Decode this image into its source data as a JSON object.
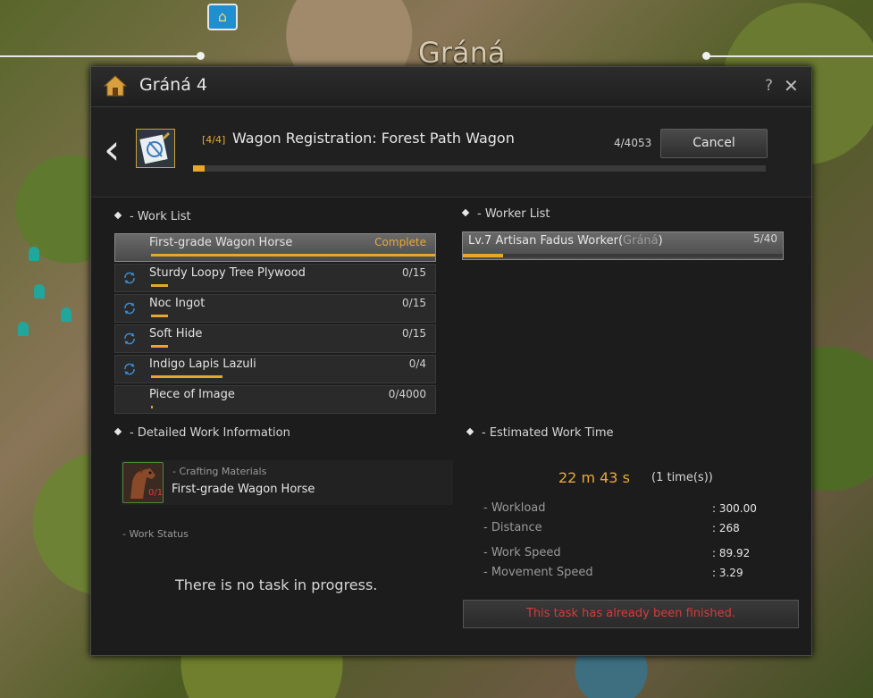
{
  "map": {
    "town_label": "Gráná"
  },
  "window": {
    "title": "Gráná 4",
    "help_label": "?",
    "close_label": "✕",
    "colors": {
      "accent": "#e8a72a",
      "alert": "#d93a3a"
    }
  },
  "task": {
    "step": "[4/4]",
    "title": "Wagon Registration: Forest Path Wagon",
    "count": "4/4053",
    "cancel_label": "Cancel",
    "progress_fraction": 0.001
  },
  "work_list": {
    "heading": "- Work List",
    "items": [
      {
        "name": "First-grade Wagon Horse",
        "count": "Complete",
        "progress": 1.0,
        "icon": "none",
        "selected": true
      },
      {
        "name": "Sturdy Loopy Tree Plywood",
        "count": "0/15",
        "progress": 0.06,
        "icon": "refresh-icon"
      },
      {
        "name": "Noc Ingot",
        "count": "0/15",
        "progress": 0.06,
        "icon": "refresh-icon"
      },
      {
        "name": "Soft Hide",
        "count": "0/15",
        "progress": 0.06,
        "icon": "refresh-icon"
      },
      {
        "name": "Indigo Lapis Lazuli",
        "count": "0/4",
        "progress": 0.25,
        "icon": "refresh-icon"
      },
      {
        "name": "Piece of Image",
        "count": "0/4000",
        "progress": 0.002,
        "icon": "none"
      }
    ]
  },
  "worker_list": {
    "heading": "- Worker List",
    "worker": {
      "name": "Lv.7 Artisan Fadus Worker(",
      "town": "Gráná",
      "close": ")",
      "count": "5/40",
      "progress": 0.125
    }
  },
  "detail": {
    "heading": "- Detailed Work Information",
    "material_label": "- Crafting Materials",
    "material_name": "First-grade Wagon Horse",
    "material_qty": "0/1",
    "status_label": "- Work Status",
    "no_task": "There is no task in progress."
  },
  "estimate": {
    "heading": "- Estimated Work Time",
    "time": "22 m 43 s",
    "times": "(1 time(s))",
    "stats": [
      {
        "label": "- Workload",
        "value": ": 300.00"
      },
      {
        "label": "- Distance",
        "value": ": 268"
      },
      {
        "label": "- Work Speed",
        "value": ": 89.92"
      },
      {
        "label": "- Movement Speed",
        "value": ": 3.29"
      }
    ],
    "finished_message": "This task has already been finished."
  }
}
